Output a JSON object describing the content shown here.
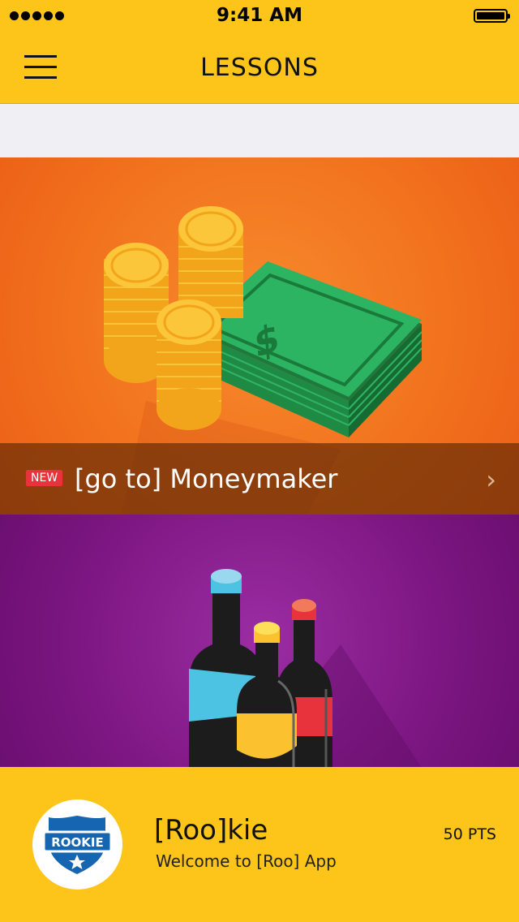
{
  "status_bar": {
    "time": "9:41 AM"
  },
  "nav": {
    "title": "LESSONS"
  },
  "lessons": [
    {
      "badge": "NEW",
      "title": "[go to] Moneymaker",
      "accent": "#f2731e"
    },
    {
      "accent": "#7e1783"
    }
  ],
  "footer": {
    "badge_label": "ROOKIE",
    "rank": "[Roo]kie",
    "subtitle": "Welcome to [Roo] App",
    "points": "50 PTS"
  },
  "colors": {
    "brand": "#fdc41a",
    "new_badge": "#e8323c"
  }
}
